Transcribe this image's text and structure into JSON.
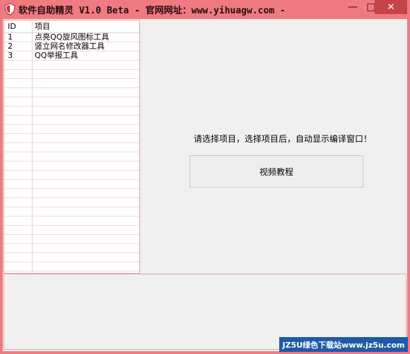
{
  "window": {
    "title": "软件自助精灵 V1.0 Beta - 官网网址：www.yihuagw.com -",
    "minimize_glyph": "—",
    "maximize_glyph": "□",
    "close_glyph": "✕"
  },
  "list": {
    "columns": [
      "ID",
      "项目"
    ],
    "rows": [
      {
        "id": "1",
        "name": "点亮QQ旋风图标工具"
      },
      {
        "id": "2",
        "name": "竖立网名修改器工具"
      },
      {
        "id": "3",
        "name": "QQ举报工具"
      }
    ]
  },
  "main": {
    "prompt": "请选择项目，选择项目后，自动显示编译窗口！",
    "video_button": "视频教程"
  },
  "watermark": "JZ5U绿色下载站www.jz5u.com",
  "colors": {
    "title_bar": "#f07a82",
    "close_button": "#c7434a",
    "watermark_bg": "#1f5aa8"
  }
}
